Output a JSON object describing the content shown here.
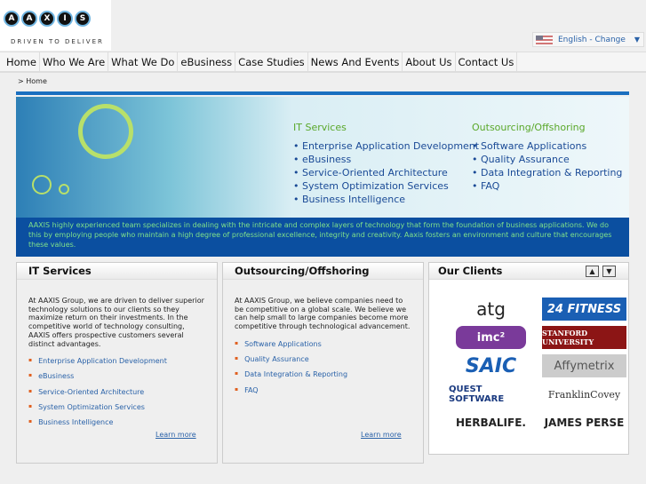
{
  "logo": {
    "letters": [
      "A",
      "A",
      "X",
      "I",
      "S"
    ],
    "tagline": "DRIVEN TO DELIVER"
  },
  "language": {
    "label": "English - Change"
  },
  "nav": [
    "Home",
    "Who We Are",
    "What We Do",
    "eBusiness",
    "Case Studies",
    "News And Events",
    "About Us",
    "Contact Us"
  ],
  "breadcrumb": "> Home",
  "banner": {
    "col1": {
      "title": "IT Services",
      "items": [
        "Enterprise Application Development",
        "eBusiness",
        "Service-Oriented Architecture",
        "System Optimization Services",
        "Business Intelligence"
      ]
    },
    "col2": {
      "title": "Outsourcing/Offshoring",
      "items": [
        "Software Applications",
        "Quality Assurance",
        "Data Integration & Reporting",
        "FAQ"
      ]
    },
    "description": "AAXIS highly experienced team specializes in dealing with the intricate and complex layers of technology that form the foundation of business applications. We do this by employing people who maintain a high degree of professional excellence, integrity and creativity. Aaxis fosters an environment and culture that encourages these values."
  },
  "it_box": {
    "title": "IT Services",
    "text": "At AAXIS Group, we are driven to deliver superior technology solutions to our clients so they maximize return on their investments. In the competitive world of technology consulting, AAXIS offers prospective customers several distinct advantages.",
    "items": [
      "Enterprise Application Development",
      "eBusiness",
      "Service-Oriented Architecture",
      "System Optimization Services",
      "Business Intelligence"
    ],
    "learn": "Learn more"
  },
  "out_box": {
    "title": "Outsourcing/Offshoring",
    "text": "At AAXIS Group, we believe companies need to be competitive on a global scale. We believe we can help small to large companies become more competitive through technological advancement.",
    "items": [
      "Software Applications",
      "Quality Assurance",
      "Data Integration & Reporting",
      "FAQ"
    ],
    "learn": "Learn more"
  },
  "clients": {
    "title": "Our Clients",
    "logos": [
      "atg",
      "24 FITNESS",
      "imc²",
      "STANFORD UNIVERSITY",
      "SAIC",
      "Affymetrix",
      "QUEST SOFTWARE",
      "FranklinCovey",
      "HERBALIFE.",
      "JAMES PERSE"
    ]
  }
}
